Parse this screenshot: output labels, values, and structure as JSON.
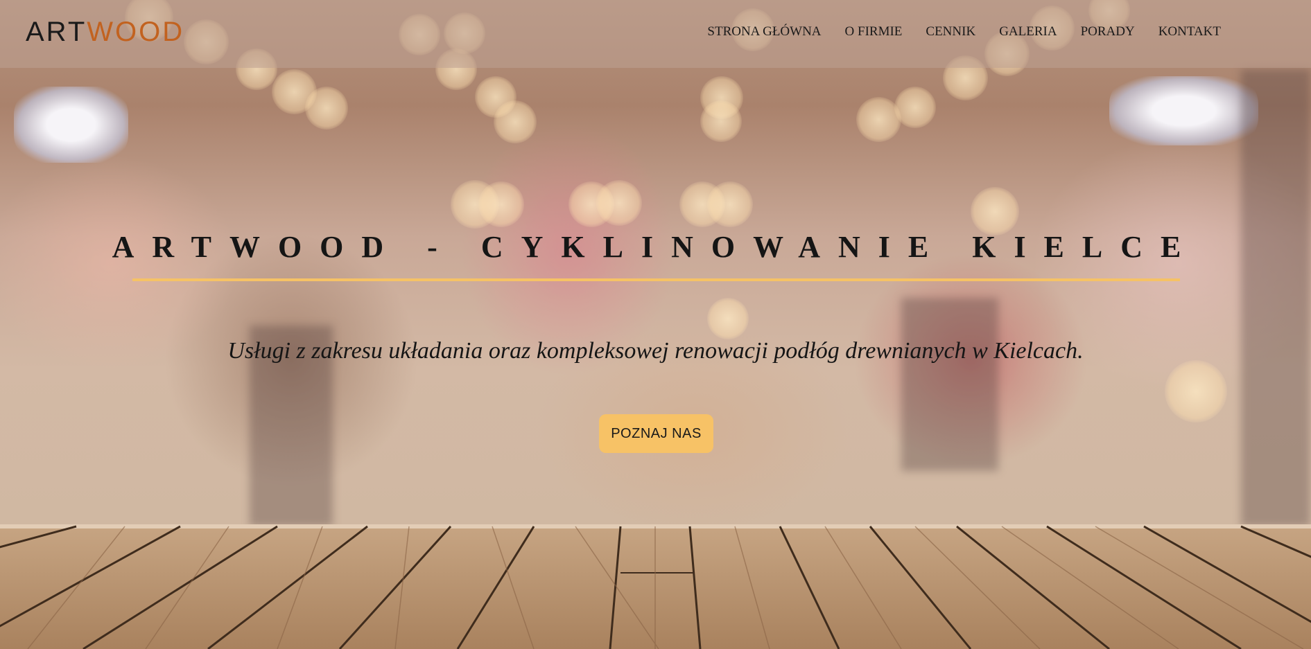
{
  "header": {
    "logo": {
      "part1": "ART",
      "part2": "WOOD"
    },
    "nav": [
      {
        "label": "STRONA GŁÓWNA"
      },
      {
        "label": "O FIRMIE"
      },
      {
        "label": "CENNIK"
      },
      {
        "label": "GALERIA"
      },
      {
        "label": "PORADY"
      },
      {
        "label": "KONTAKT"
      }
    ]
  },
  "hero": {
    "title": "ARTWOOD - CYKLINOWANIE KIELCE",
    "subtitle": "Usługi z zakresu układania oraz kompleksowej renowacji podłóg drewnianych w Kielcach.",
    "cta_label": "POZNAJ NAS"
  },
  "colors": {
    "accent": "#f7c266",
    "logo_accent": "#c2621f",
    "text": "#151515"
  }
}
